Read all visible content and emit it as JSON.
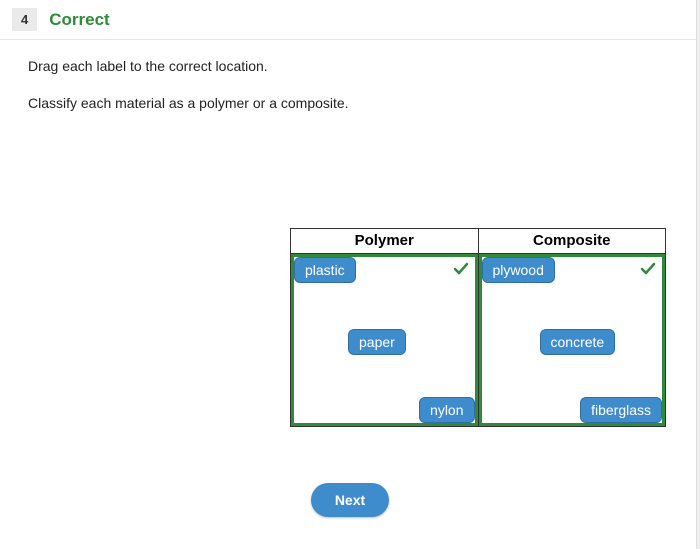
{
  "header": {
    "question_number": "4",
    "status": "Correct"
  },
  "instructions": {
    "line1": "Drag each label to the correct location.",
    "line2": "Classify each material as a polymer or a composite."
  },
  "columns": {
    "left": {
      "title": "Polymer",
      "correct": true,
      "chips": [
        "plastic",
        "paper",
        "nylon"
      ]
    },
    "right": {
      "title": "Composite",
      "correct": true,
      "chips": [
        "plywood",
        "concrete",
        "fiberglass"
      ]
    }
  },
  "next_button": "Next",
  "colors": {
    "correct_green": "#2f8a3a",
    "chip_blue": "#3f8ccc"
  }
}
